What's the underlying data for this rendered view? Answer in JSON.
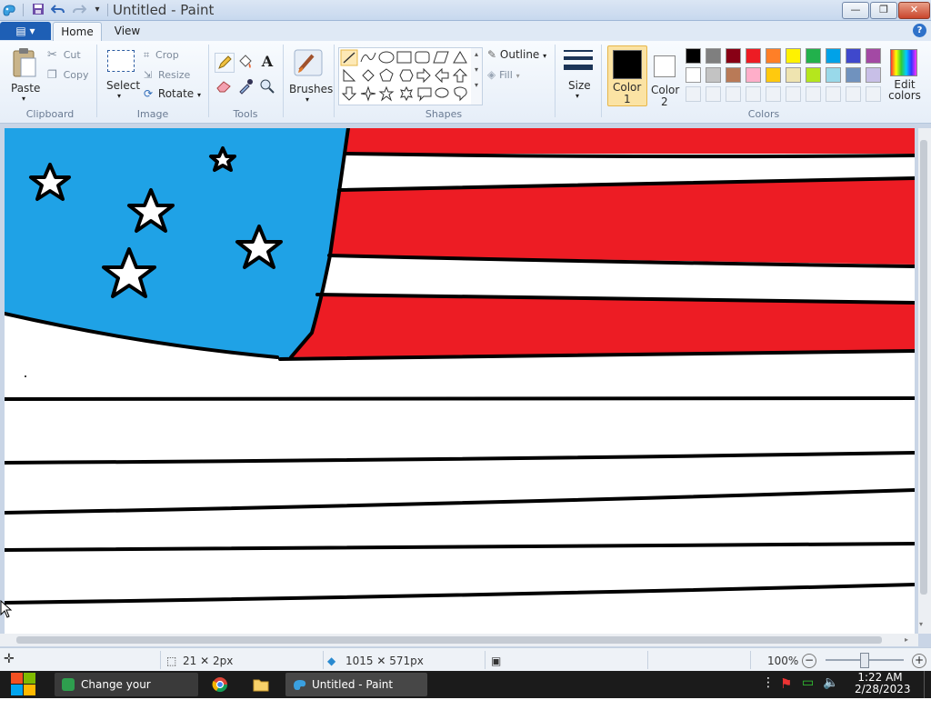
{
  "window": {
    "title": "Untitled - Paint",
    "minimize_label": "—",
    "maximize_label": "❐",
    "close_label": "✕"
  },
  "ribbon": {
    "file_tab_label": "▤ ▾",
    "tabs": [
      {
        "label": "Home"
      },
      {
        "label": "View"
      }
    ],
    "help_label": "?",
    "groups": {
      "clipboard": {
        "label": "Clipboard",
        "paste": "Paste",
        "cut": "Cut",
        "copy": "Copy"
      },
      "image": {
        "label": "Image",
        "select": "Select",
        "crop": "Crop",
        "resize": "Resize",
        "rotate": "Rotate"
      },
      "tools": {
        "label": "Tools"
      },
      "brushes": {
        "label": "Brushes"
      },
      "shapes": {
        "label": "Shapes",
        "outline": "Outline",
        "fill": "Fill"
      },
      "size": {
        "label": "Size"
      },
      "color1": {
        "label_line1": "Color",
        "label_line2": "1"
      },
      "color2": {
        "label_line1": "Color",
        "label_line2": "2"
      },
      "colors": {
        "label": "Colors",
        "edit": "Edit colors"
      }
    },
    "palette_row1": [
      "#000000",
      "#7f7f7f",
      "#880015",
      "#ed1c24",
      "#ff7f27",
      "#fff200",
      "#22b14c",
      "#00a2e8",
      "#3f48cc",
      "#a349a4"
    ],
    "palette_row2": [
      "#ffffff",
      "#c3c3c3",
      "#b97a57",
      "#ffaec9",
      "#ffc90e",
      "#efe4b0",
      "#b5e61d",
      "#99d9ea",
      "#7092be",
      "#c8bfe7"
    ],
    "color1_value": "#000000",
    "color2_value": "#ffffff"
  },
  "canvas": {
    "stripe_red": "#ed1c24",
    "canton_blue": "#1fa2e6",
    "outline": "#000000"
  },
  "status": {
    "selection_size": "21 ✕ 2px",
    "image_size": "1015 ✕ 571px",
    "zoom": "100%"
  },
  "taskbar": {
    "items": [
      {
        "label": "Change your deskto..."
      },
      {
        "label": ""
      },
      {
        "label": ""
      },
      {
        "label": "Untitled - Paint"
      }
    ],
    "time": "1:22 AM",
    "date": "2/28/2023"
  }
}
